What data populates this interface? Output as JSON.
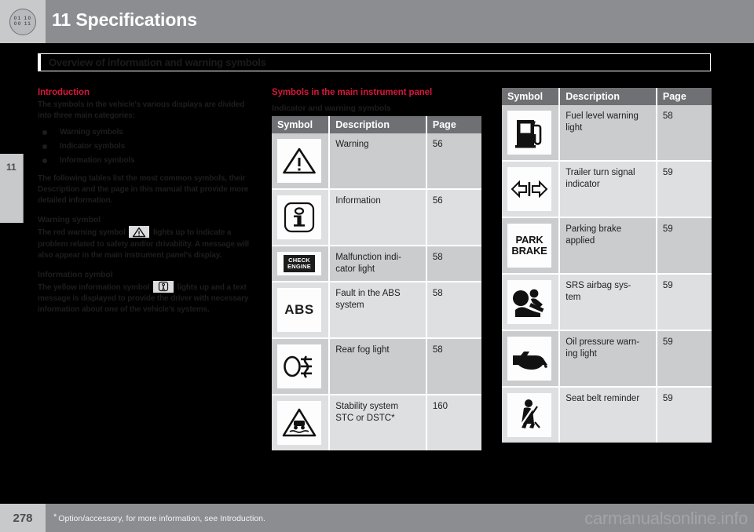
{
  "header": {
    "chapter_title": "11 Specifications",
    "dial_rows": [
      "01 10",
      "00 11"
    ],
    "chapter_tab_number": "11"
  },
  "section": {
    "band_title": "Overview of information and warning symbols"
  },
  "left_column": {
    "intro_heading": "Introduction",
    "intro_paragraph": "The symbols in the vehicle's various displays are divided into three main categories:",
    "bullets": [
      "Warning symbols",
      "Indicator symbols",
      "Information symbols"
    ],
    "intro_paragraph2": "The following tables list the most common symbols, their Description and the page in this manual that provide more detailed information.",
    "warning_heading": "Warning symbol",
    "warning_text_before": "The red warning symbol",
    "warning_text_after": "lights up to indicate a problem related to safety and/or drivability. A message will also appear in the main instrument panel's display.",
    "info_heading": "Information symbol",
    "info_text_before": "The yellow information symbol",
    "info_text_after": "lights up and a text message is displayed to provide the driver with necessary information about one of the vehicle's systems."
  },
  "middle_column": {
    "title": "Symbols in the main instrument panel",
    "subtitle": "Indicator and warning symbols",
    "table": {
      "headers": [
        "Symbol",
        "Description",
        "Page"
      ],
      "rows": [
        {
          "icon": "warning-triangle-icon",
          "description": "Warning",
          "page": "56"
        },
        {
          "icon": "information-i-icon",
          "description": "Information",
          "page": "56"
        },
        {
          "icon": "check-engine-icon",
          "icon_text_line1": "CHECK",
          "icon_text_line2": "ENGINE",
          "description": "Malfunction indi-\ncator light",
          "page": "58"
        },
        {
          "icon": "abs-icon",
          "icon_text": "ABS",
          "description": "Fault in the ABS\nsystem",
          "page": "58"
        },
        {
          "icon": "rear-fog-light-icon",
          "description": "Rear fog light",
          "page": "58"
        },
        {
          "icon": "stability-system-icon",
          "description": "Stability system\nSTC or DSTC*",
          "page": "160"
        }
      ]
    }
  },
  "right_column": {
    "table": {
      "headers": [
        "Symbol",
        "Description",
        "Page"
      ],
      "rows": [
        {
          "icon": "fuel-pump-icon",
          "description": "Fuel level warning\nlight",
          "page": "58"
        },
        {
          "icon": "trailer-turn-signal-icon",
          "description": "Trailer turn signal\nindicator",
          "page": "59"
        },
        {
          "icon": "park-brake-icon",
          "icon_text_line1": "PARK",
          "icon_text_line2": "BRAKE",
          "description": "Parking brake\napplied",
          "page": "59"
        },
        {
          "icon": "srs-airbag-icon",
          "description": "SRS airbag sys-\ntem",
          "page": "59"
        },
        {
          "icon": "oil-pressure-icon",
          "description": "Oil pressure warn-\ning light",
          "page": "59"
        },
        {
          "icon": "seat-belt-reminder-icon",
          "description": "Seat belt reminder",
          "page": "59"
        }
      ]
    }
  },
  "footer": {
    "page_number": "278",
    "star": "*",
    "note": "Option/accessory, for more information, see Introduction.",
    "watermark": "carmanualsonline.info"
  },
  "colors": {
    "accent_red": "#d5173c",
    "header_gray": "#8b8d91",
    "table_header_gray": "#6e7074",
    "row_light": "#dedfe1",
    "row_dark": "#cbccce"
  }
}
